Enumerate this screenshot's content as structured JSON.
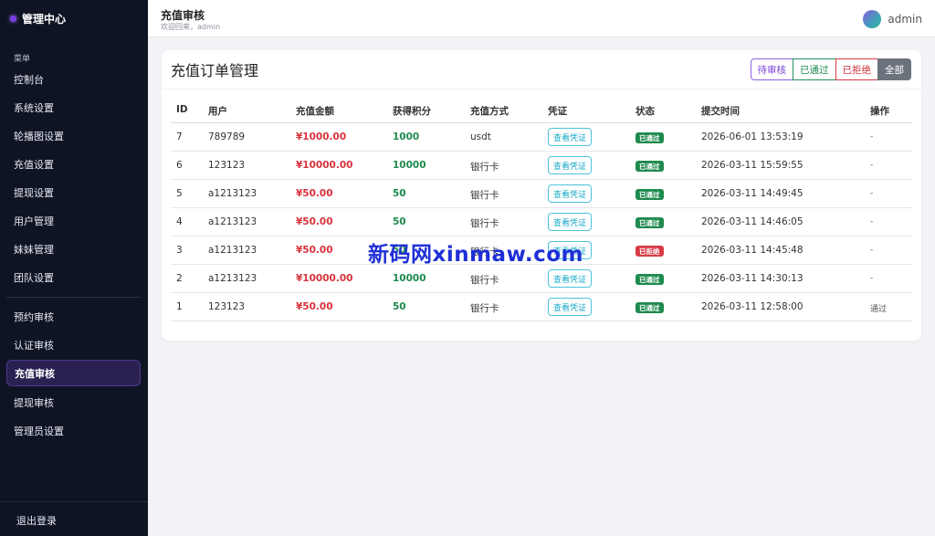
{
  "sidebar": {
    "brand": "管理中心",
    "section_label": "菜单",
    "items": [
      {
        "label": "控制台"
      },
      {
        "label": "系统设置"
      },
      {
        "label": "轮播图设置"
      },
      {
        "label": "充值设置"
      },
      {
        "label": "提现设置"
      },
      {
        "label": "用户管理"
      },
      {
        "label": "妹妹管理"
      },
      {
        "label": "团队设置"
      },
      {
        "label": "预约审核"
      },
      {
        "label": "认证审核"
      },
      {
        "label": "充值审核"
      },
      {
        "label": "提现审核"
      },
      {
        "label": "管理员设置"
      }
    ],
    "active_item": "充值审核",
    "logout": "退出登录"
  },
  "header": {
    "title": "充值审核",
    "welcome": "欢迎回来，admin",
    "username": "admin"
  },
  "card": {
    "title": "充值订单管理",
    "filters": [
      "待审核",
      "已通过",
      "已拒绝",
      "全部"
    ],
    "active_filter": "全部"
  },
  "table": {
    "columns": [
      "ID",
      "用户",
      "充值金额",
      "获得积分",
      "充值方式",
      "凭证",
      "状态",
      "提交时间",
      "操作"
    ],
    "rows": [
      {
        "id": "7",
        "user": "789789",
        "amount": "¥1000.00",
        "points": "1000",
        "method": "usdt",
        "proof": "查看凭证",
        "status": "已通过",
        "status_type": "ok",
        "time": "2026-06-01 13:53:19",
        "action": "-"
      },
      {
        "id": "6",
        "user": "123123",
        "amount": "¥10000.00",
        "points": "10000",
        "method": "银行卡",
        "proof": "查看凭证",
        "status": "已通过",
        "status_type": "ok",
        "time": "2026-03-11 15:59:55",
        "action": "-"
      },
      {
        "id": "5",
        "user": "a1213123",
        "amount": "¥50.00",
        "points": "50",
        "method": "银行卡",
        "proof": "查看凭证",
        "status": "已通过",
        "status_type": "ok",
        "time": "2026-03-11 14:49:45",
        "action": "-"
      },
      {
        "id": "4",
        "user": "a1213123",
        "amount": "¥50.00",
        "points": "50",
        "method": "银行卡",
        "proof": "查看凭证",
        "status": "已通过",
        "status_type": "ok",
        "time": "2026-03-11 14:46:05",
        "action": "-"
      },
      {
        "id": "3",
        "user": "a1213123",
        "amount": "¥50.00",
        "points": "50",
        "method": "银行卡",
        "proof": "查看凭证",
        "status": "已拒绝",
        "status_type": "no",
        "time": "2026-03-11 14:45:48",
        "action": "-"
      },
      {
        "id": "2",
        "user": "a1213123",
        "amount": "¥10000.00",
        "points": "10000",
        "method": "银行卡",
        "proof": "查看凭证",
        "status": "已通过",
        "status_type": "ok",
        "time": "2026-03-11 14:30:13",
        "action": "-"
      },
      {
        "id": "1",
        "user": "123123",
        "amount": "¥50.00",
        "points": "50",
        "method": "银行卡",
        "proof": "查看凭证",
        "status": "已通过",
        "status_type": "ok",
        "time": "2026-03-11 12:58:00",
        "action": "通过"
      }
    ]
  },
  "watermark": "新码网xinmaw.com",
  "colors": {
    "sidebar_bg": "#0f1424",
    "active_nav_bg": "#2a2150",
    "amount_red": "#d8323c",
    "points_green": "#1e8a4e",
    "proof_cyan": "#17a9c6",
    "badge_ok": "#1e8a4e",
    "badge_no": "#d83a46"
  }
}
